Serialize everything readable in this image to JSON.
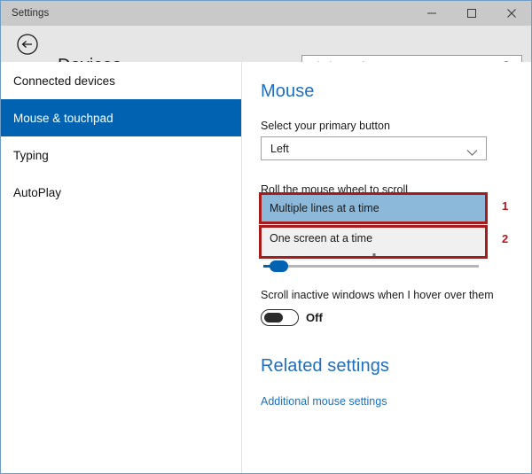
{
  "window": {
    "title": "Settings",
    "border_color": "#6f9cc4",
    "titlebar_color": "#c9c9c9",
    "header_color": "#e6e6e6",
    "controls": {
      "minimize": "minimize-icon",
      "maximize": "maximize-icon",
      "close": "close-icon"
    }
  },
  "header": {
    "back_icon": "back-arrow-icon",
    "page_title": "Devices",
    "pin_icon": "pin-icon"
  },
  "search": {
    "placeholder": "Find a setting",
    "value": "",
    "icon": "search-icon"
  },
  "sidebar": {
    "items": [
      {
        "label": "Connected devices",
        "selected": false
      },
      {
        "label": "Mouse & touchpad",
        "selected": true
      },
      {
        "label": "Typing",
        "selected": false
      },
      {
        "label": "AutoPlay",
        "selected": false
      }
    ],
    "selected_color": "#0062b1"
  },
  "main": {
    "heading": "Mouse",
    "heading_color": "#1d6fc0",
    "primary_button": {
      "label": "Select your primary button",
      "value": "Left",
      "chevron": "chevron-down-icon"
    },
    "scroll_setting": {
      "label": "Roll the mouse wheel to scroll",
      "options": [
        {
          "label": "Multiple lines at a time",
          "highlighted": true
        },
        {
          "label": "One screen at a time",
          "highlighted": false
        }
      ],
      "highlight_color": "#8cb9da"
    },
    "lines_slider": {
      "value_fraction": 0.05
    },
    "inactive_scroll": {
      "label": "Scroll inactive windows when I hover over them",
      "state": "Off"
    },
    "related": {
      "heading": "Related settings",
      "link": "Additional mouse settings"
    }
  },
  "annotations": {
    "color": "#a61c1c",
    "number_color": "#b5181c",
    "markers": [
      {
        "number": "1"
      },
      {
        "number": "2"
      }
    ]
  }
}
